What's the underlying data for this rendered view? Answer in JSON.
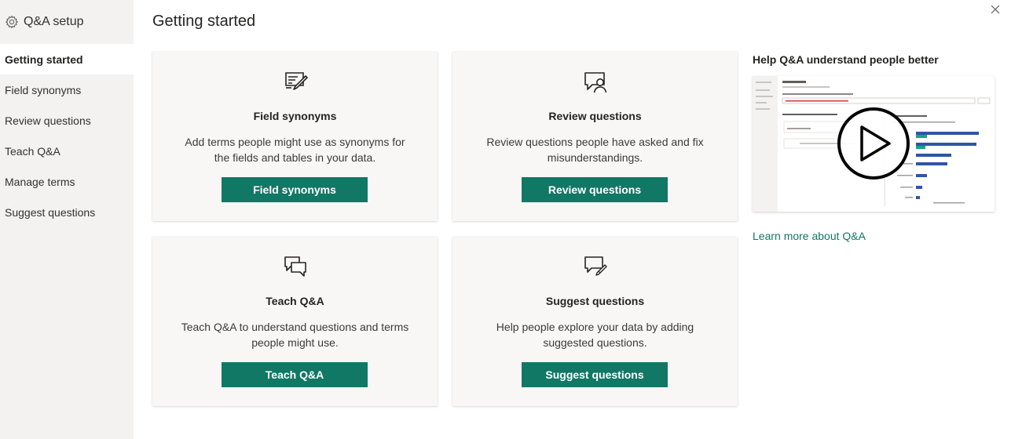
{
  "sidebar": {
    "title": "Q&A setup",
    "title_icon": "gear-icon",
    "items": [
      {
        "label": "Getting started",
        "active": true
      },
      {
        "label": "Field synonyms",
        "active": false
      },
      {
        "label": "Review questions",
        "active": false
      },
      {
        "label": "Teach Q&A",
        "active": false
      },
      {
        "label": "Manage terms",
        "active": false
      },
      {
        "label": "Suggest questions",
        "active": false
      }
    ]
  },
  "main": {
    "title": "Getting started",
    "cards": [
      {
        "icon": "field-synonyms-icon",
        "title": "Field synonyms",
        "description": "Add terms people might use as synonyms for the fields and tables in your data.",
        "button": "Field synonyms"
      },
      {
        "icon": "review-questions-icon",
        "title": "Review questions",
        "description": "Review questions people have asked and fix misunderstandings.",
        "button": "Review questions"
      },
      {
        "icon": "teach-qa-icon",
        "title": "Teach Q&A",
        "description": "Teach Q&A to understand questions and terms people might use.",
        "button": "Teach Q&A"
      },
      {
        "icon": "suggest-questions-icon",
        "title": "Suggest questions",
        "description": "Help people explore your data by adding suggested questions.",
        "button": "Suggest questions"
      }
    ]
  },
  "help": {
    "title": "Help Q&A understand people better",
    "link": "Learn more about Q&A"
  },
  "colors": {
    "accent": "#117865",
    "sidebar_bg": "#f3f2f1",
    "card_bg": "#f8f7f6",
    "chart_blue": "#2f55a4",
    "chart_teal": "#1aa38a"
  },
  "close_icon": "close-icon"
}
